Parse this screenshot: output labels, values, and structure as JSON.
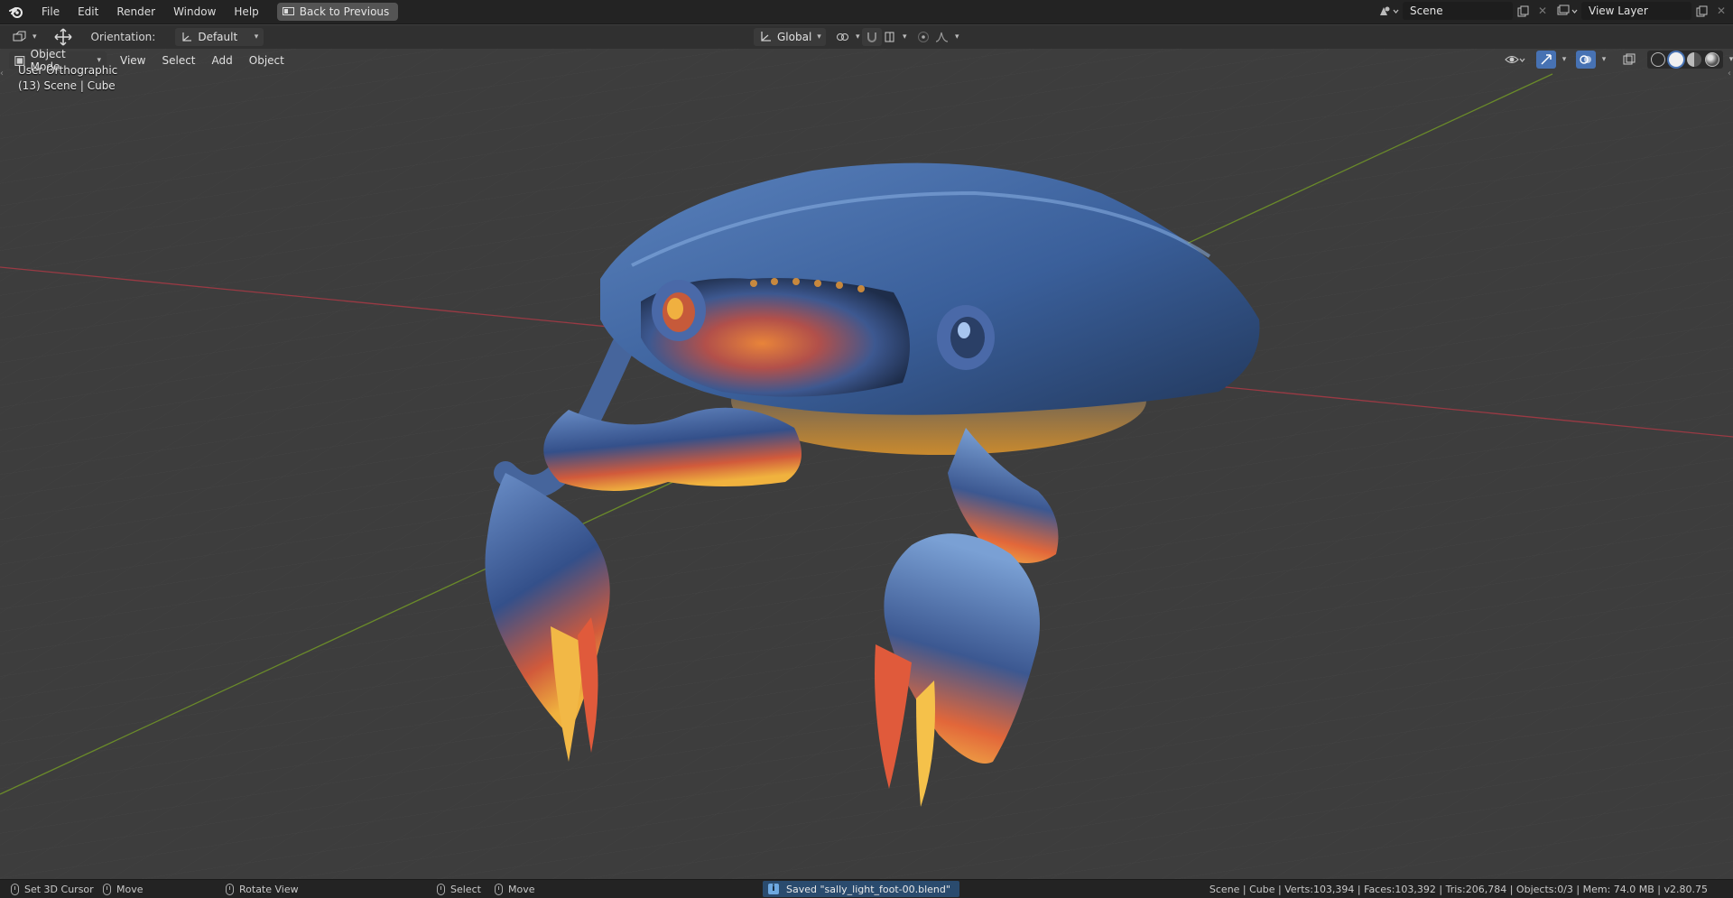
{
  "menubar": {
    "items": [
      "File",
      "Edit",
      "Render",
      "Window",
      "Help"
    ],
    "back_button": "Back to Previous"
  },
  "scene": {
    "value": "Scene"
  },
  "view_layer": {
    "value": "View Layer"
  },
  "tool_header": {
    "orientation_label": "Orientation:",
    "orientation_value": "Default",
    "transform_orientation": "Global"
  },
  "view_header": {
    "mode": "Object Mode",
    "menus": [
      "View",
      "Select",
      "Add",
      "Object"
    ]
  },
  "viewport": {
    "view_name": "User Orthographic",
    "object_info": "(13) Scene | Cube",
    "colors": {
      "background": "#3d3d3d",
      "grid": "#464646",
      "x_axis": "#9a3a44",
      "y_axis": "#6a8a2a",
      "accent": "#4772b3"
    }
  },
  "statusbar": {
    "hints": [
      "Set 3D Cursor",
      "Move",
      "Rotate View",
      "Select",
      "Move"
    ],
    "message": "Saved \"sally_light_foot-00.blend\"",
    "stats": "Scene | Cube | Verts:103,394 | Faces:103,392 | Tris:206,784 | Objects:0/3 | Mem: 74.0 MB | v2.80.75"
  }
}
